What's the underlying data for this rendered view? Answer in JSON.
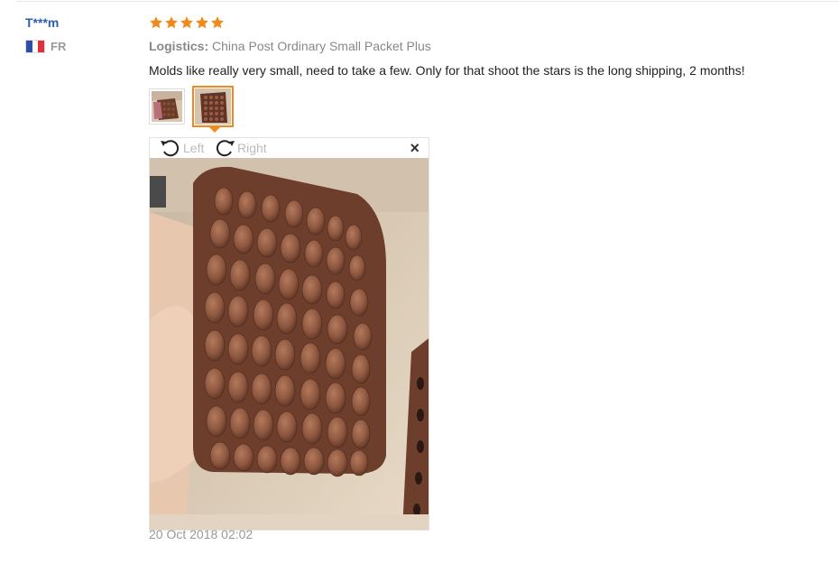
{
  "user": {
    "name": "T***m",
    "country_code": "FR",
    "flag_colors": [
      "#2b4fa8",
      "#ffffff",
      "#e0313b"
    ]
  },
  "review": {
    "rating": 5,
    "star_color": "#f08a1c",
    "logistics_label": "Logistics:",
    "logistics_value": "China Post Ordinary Small Packet Plus",
    "text": "Molds like really very small, need to take a few. Only for that shoot the stars is the long shipping, 2 months!",
    "date": "20 Oct 2018 02:02"
  },
  "viewer": {
    "rotate_left_label": "Left",
    "rotate_right_label": "Right",
    "close_glyph": "×",
    "accent_color": "#f08a1c"
  }
}
